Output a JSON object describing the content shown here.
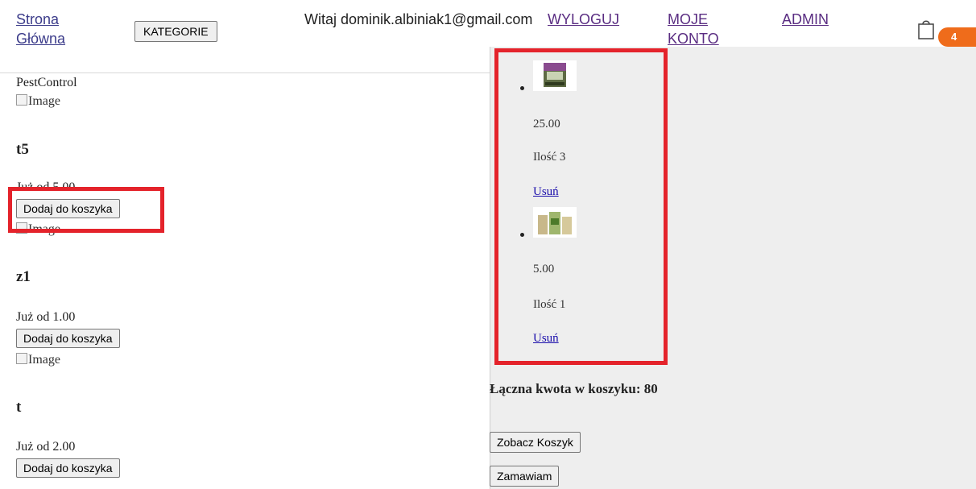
{
  "nav": {
    "home_label": "Strona Główna",
    "categories_label": "KATEGORIE",
    "greeting": "Witaj dominik.albiniak1@gmail.com",
    "logout_label": "WYLOGUJ",
    "account_label": "MOJE KONTO",
    "admin_label": "ADMIN",
    "cart_count": "4"
  },
  "store": {
    "brand": "PestControl",
    "img_alt": "Image",
    "add_label": "Dodaj do koszyka",
    "products": [
      {
        "name": "t5",
        "price": "Już od 5.00"
      },
      {
        "name": "z1",
        "price": "Już od 1.00"
      },
      {
        "name": "t",
        "price": "Już od 2.00"
      }
    ]
  },
  "cart": {
    "items": [
      {
        "price": "25.00",
        "qty": "Ilość 3",
        "remove": "Usuń"
      },
      {
        "price": "5.00",
        "qty": "Ilość 1",
        "remove": "Usuń"
      }
    ],
    "total": "Łączna kwota w koszyku: 80",
    "view_cart_label": "Zobacz Koszyk",
    "order_label": "Zamawiam"
  },
  "colors": {
    "highlight": "#e4232b",
    "badge": "#ef6c1b",
    "link_visited": "#5a2d82"
  }
}
